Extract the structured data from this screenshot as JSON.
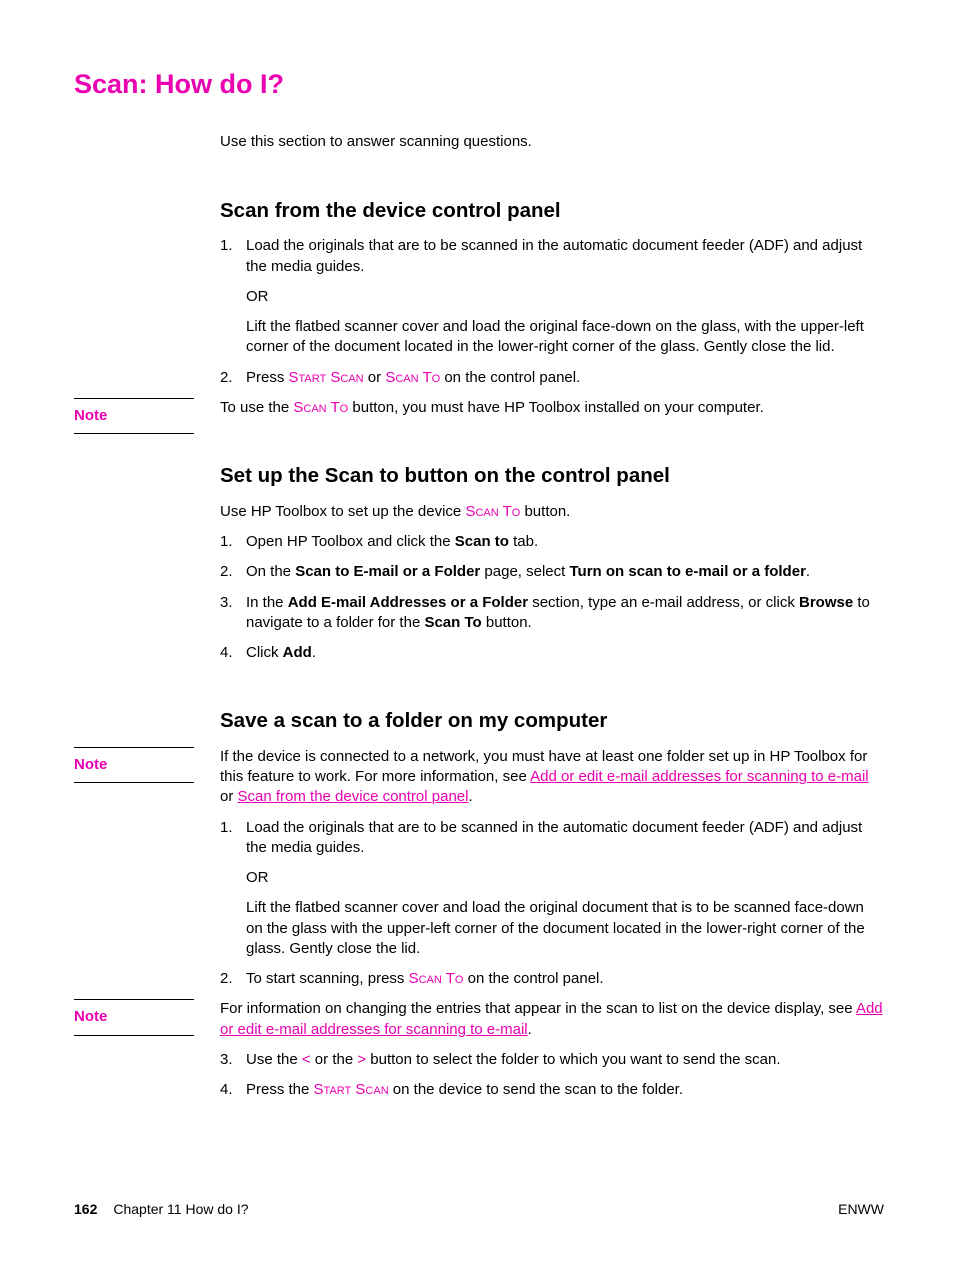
{
  "pageTitle": "Scan: How do I?",
  "intro": "Use this section to answer scanning questions.",
  "noteLabel": "Note",
  "section1": {
    "heading": "Scan from the device control panel",
    "step1a": "Load the originals that are to be scanned in the automatic document feeder (ADF) and adjust the media guides.",
    "or": "OR",
    "step1b": "Lift the flatbed scanner cover and load the original face-down on the glass, with the upper-left corner of the document located in the lower-right corner of the glass. Gently close the lid.",
    "step2_pre": "Press ",
    "startScan": "Start Scan",
    "or_word": " or ",
    "scanTo": "Scan To",
    "step2_post": " on the control panel.",
    "note_pre": "To use the ",
    "note_post": " button, you must have HP Toolbox installed on your computer."
  },
  "section2": {
    "heading": "Set up the Scan to button on the control panel",
    "intro_pre": "Use HP Toolbox to set up the device ",
    "intro_post": " button.",
    "step1_pre": "Open HP Toolbox and click the ",
    "scanto_bold": "Scan to",
    "step1_post": " tab.",
    "step2_pre": "On the ",
    "scanToEmailFolder": "Scan to E-mail or a Folder",
    "step2_mid": " page, select ",
    "turnOn": "Turn on scan to e-mail or a folder",
    "step2_post": ".",
    "step3_pre": "In the ",
    "addEmail": "Add E-mail Addresses or a Folder",
    "step3_mid": " section, type an e-mail address, or click ",
    "browse": "Browse",
    "step3_mid2": " to navigate to a folder for the ",
    "scanTo_bold": "Scan To",
    "step3_post": " button.",
    "step4_pre": "Click ",
    "add": "Add",
    "step4_post": "."
  },
  "section3": {
    "heading": "Save a scan to a folder on my computer",
    "note1_pre": "If the device is connected to a network, you must have at least one folder set up in HP Toolbox for this feature to work. For more information, see ",
    "link_addedit": "Add or edit e-mail addresses for scanning to e-mail",
    "note1_mid": " or ",
    "link_scanfrom": "Scan from the device control panel",
    "note1_post": ".",
    "step1a": "Load the originals that are to be scanned in the automatic document feeder (ADF) and adjust the media guides.",
    "or": "OR",
    "step1b": "Lift the flatbed scanner cover and load the original document that is to be scanned face-down on the glass with the upper-left corner of the document located in the lower-right corner of the glass. Gently close the lid.",
    "step2_pre": "To start scanning, press ",
    "step2_post": " on the control panel.",
    "note2_pre": "For information on changing the entries that appear in the scan to list on the device display, see ",
    "note2_post": ".",
    "step3_pre": "Use the ",
    "lt": "<",
    "step3_mid": " or the ",
    "gt": ">",
    "step3_post": " button to select the folder to which you want to send the scan.",
    "step4_pre": "Press the ",
    "step4_post": " on the device to send the scan to the folder."
  },
  "footer": {
    "page": "162",
    "chapter": "Chapter 11  How do I?",
    "right": "ENWW"
  }
}
